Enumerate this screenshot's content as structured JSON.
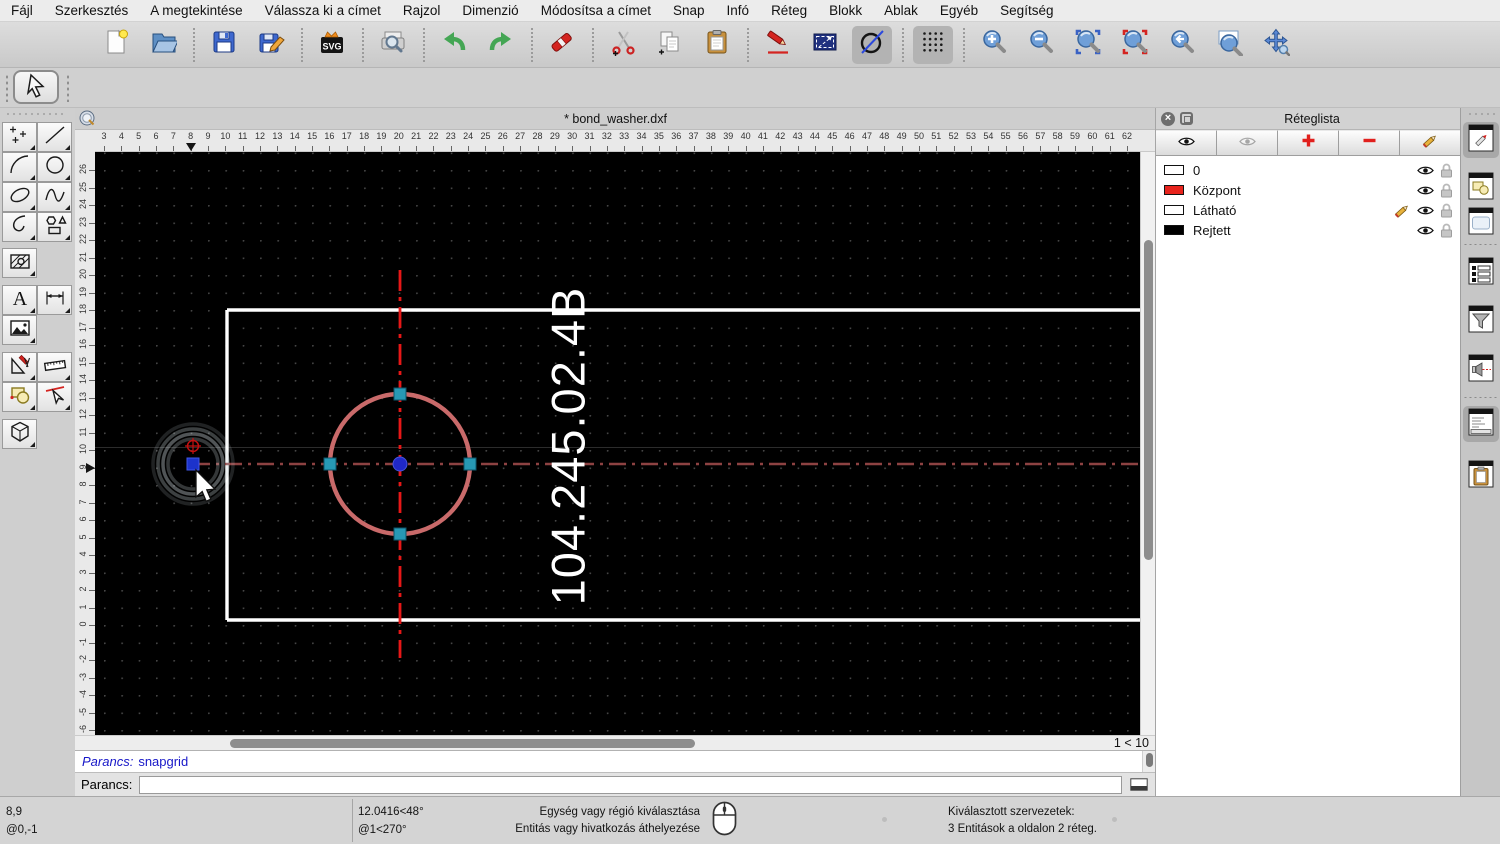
{
  "menu": {
    "items": [
      "Fájl",
      "Szerkesztés",
      "A megtekintése",
      "Válassza ki a címet",
      "Rajzol",
      "Dimenzió",
      "Módosítsa a címet",
      "Snap",
      "Infó",
      "Réteg",
      "Blokk",
      "Ablak",
      "Egyéb",
      "Segítség"
    ]
  },
  "toolbar": {
    "groups": [
      {
        "buttons": [
          {
            "name": "new-file"
          },
          {
            "name": "open-folder"
          }
        ]
      },
      {
        "buttons": [
          {
            "name": "save"
          },
          {
            "name": "save-as"
          }
        ]
      },
      {
        "buttons": [
          {
            "name": "svg-export"
          }
        ]
      },
      {
        "buttons": [
          {
            "name": "print-preview"
          }
        ]
      },
      {
        "buttons": [
          {
            "name": "undo"
          },
          {
            "name": "redo"
          }
        ]
      },
      {
        "buttons": [
          {
            "name": "delete"
          }
        ]
      },
      {
        "buttons": [
          {
            "name": "cut"
          },
          {
            "name": "copy"
          },
          {
            "name": "paste"
          }
        ]
      },
      {
        "buttons": [
          {
            "name": "pen-edit"
          },
          {
            "name": "selection-rectangle"
          },
          {
            "name": "circle-line",
            "pressed": true
          }
        ]
      },
      {
        "buttons": [
          {
            "name": "snap-grid",
            "pressed": true
          }
        ]
      },
      {
        "buttons": [
          {
            "name": "zoom-in"
          },
          {
            "name": "zoom-out"
          },
          {
            "name": "zoom-auto"
          },
          {
            "name": "zoom-redraw"
          },
          {
            "name": "zoom-previous"
          },
          {
            "name": "zoom-window"
          },
          {
            "name": "zoom-pan"
          }
        ]
      }
    ]
  },
  "tool_options": {
    "selected_tool": "select-arrow"
  },
  "palette": {
    "rows": [
      {
        "cells": [
          "points",
          "line"
        ]
      },
      {
        "cells": [
          "arc",
          "circle"
        ]
      },
      {
        "cells": [
          "ellipse",
          "spline"
        ]
      },
      {
        "cells": [
          "polyline",
          "polygon"
        ]
      },
      {
        "cells": [
          "hatch"
        ]
      },
      {
        "cells": [
          "text",
          "dimension"
        ]
      },
      {
        "cells": [
          "image"
        ]
      },
      {
        "cells": [
          "modify",
          "measure"
        ]
      },
      {
        "cells": [
          "block",
          "select-entity"
        ]
      },
      {
        "cells": [
          "solid-3d"
        ]
      }
    ]
  },
  "document": {
    "title": "* bond_washer.dxf"
  },
  "rulers": {
    "horizontal": {
      "start": 3,
      "end": 62,
      "marker": 8
    },
    "vertical": {
      "start": 26,
      "end": -6,
      "marker": 9
    }
  },
  "drawing": {
    "part_label": "104.245.02.4B",
    "colors": {
      "selected": "#c96a6a",
      "centerline_vertical": "#e61717",
      "centerline_horizontal": "#8d4242",
      "handle": "#2798b4",
      "center_point": "#2028c8",
      "outline": "#ffffff"
    }
  },
  "zoom_ratio": "1 < 10",
  "layer_panel": {
    "title": "Réteglista",
    "toolbar": [
      "show-all-eye",
      "hide-all-eye",
      "add-layer",
      "remove-layer",
      "edit-layer"
    ],
    "layers": [
      {
        "name": "0",
        "color": "#ffffff",
        "current": false
      },
      {
        "name": "Központ",
        "color": "#e8241d",
        "current": false
      },
      {
        "name": "Látható",
        "color": "#ffffff",
        "current": true
      },
      {
        "name": "Rejtett",
        "color": "#000000",
        "current": false
      }
    ]
  },
  "dock": {
    "items": [
      {
        "name": "layer-list-widget",
        "active": true
      },
      {
        "name": "block-list-widget",
        "active": false
      },
      {
        "name": "library-widget",
        "active": false
      },
      {
        "name": "entity-list-widget",
        "active": false
      },
      {
        "name": "filter-widget",
        "active": false
      },
      {
        "name": "fit-widget",
        "active": false
      },
      {
        "name": "command-widget",
        "active": true
      },
      {
        "name": "clipboard-widget",
        "active": false
      }
    ]
  },
  "command": {
    "history_prompt": "Parancs:",
    "history_text": "snapgrid",
    "input_label": "Parancs:",
    "input_value": ""
  },
  "status": {
    "abs_coord": "8,9",
    "rel_coord": "@0,-1",
    "polar_abs": "12.0416<48°",
    "polar_rel": "@1<270°",
    "hint_line1": "Egység vagy régió kiválasztása",
    "hint_line2": "Entitás vagy hivatkozás áthelyezése",
    "selection_line1": "Kiválasztott szervezetek:",
    "selection_line2": "3 Entitások a oldalon 2 réteg."
  }
}
